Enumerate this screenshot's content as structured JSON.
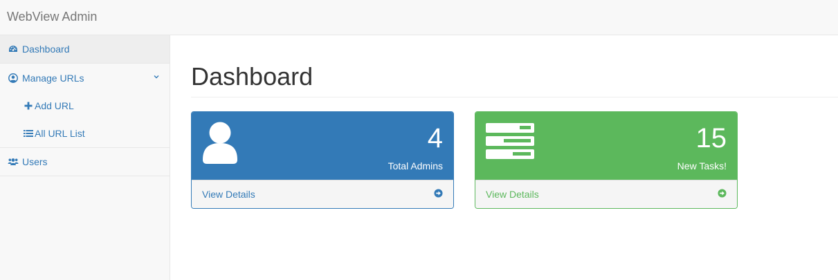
{
  "navbar": {
    "brand": "WebView Admin"
  },
  "sidebar": {
    "items": [
      {
        "label": "Dashboard",
        "icon": "dashboard-icon",
        "active": true
      },
      {
        "label": "Manage URLs",
        "icon": "user-circle-icon",
        "expanded": true,
        "children": [
          {
            "label": "Add URL",
            "icon": "plus-icon"
          },
          {
            "label": "All URL List",
            "icon": "list-icon"
          }
        ]
      },
      {
        "label": "Users",
        "icon": "users-icon"
      }
    ]
  },
  "main": {
    "title": "Dashboard",
    "panels": [
      {
        "count": "4",
        "label": "Total Admins",
        "link": "View Details",
        "color": "#337ab7",
        "icon": "user-icon"
      },
      {
        "count": "15",
        "label": "New Tasks!",
        "link": "View Details",
        "color": "#5cb85c",
        "icon": "tasks-icon"
      }
    ]
  },
  "colors": {
    "primary": "#337ab7",
    "success": "#5cb85c",
    "sidebar_bg": "#f8f8f8"
  }
}
